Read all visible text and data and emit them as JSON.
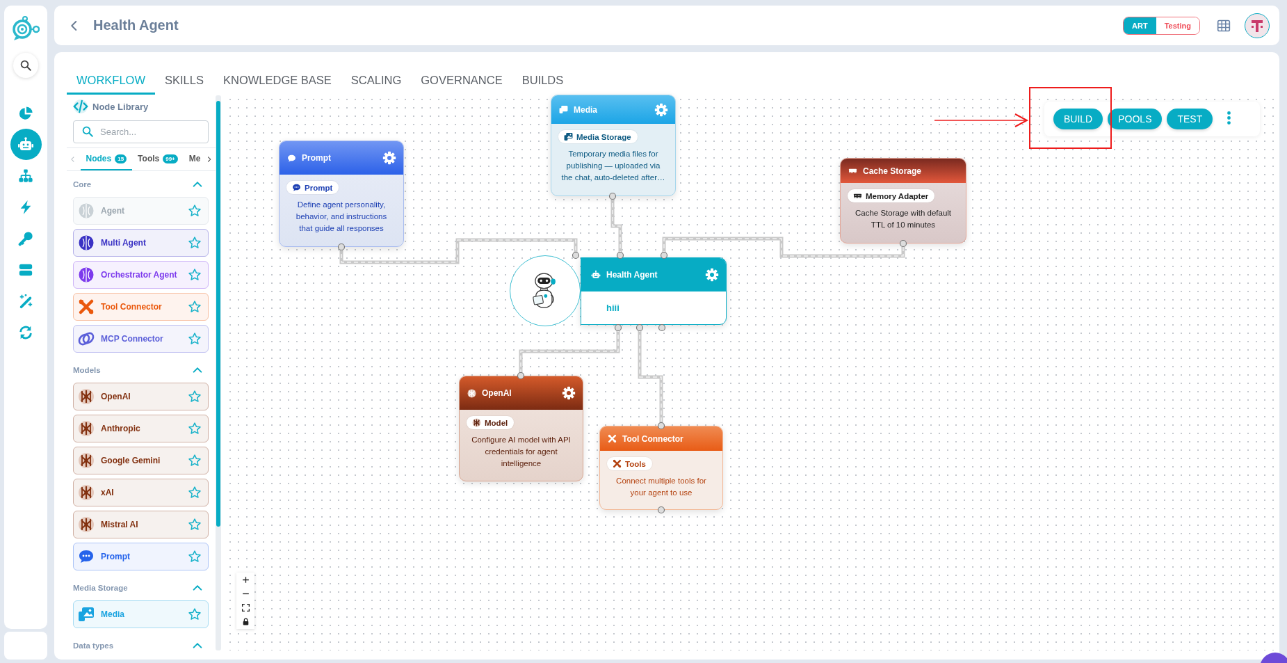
{
  "rail": {
    "items": [
      {
        "selected": false
      },
      {
        "selected": true
      },
      {
        "selected": false
      },
      {
        "selected": false
      },
      {
        "selected": false
      },
      {
        "selected": false
      },
      {
        "selected": false
      },
      {
        "selected": false
      }
    ]
  },
  "header": {
    "title": "Health Agent",
    "environments": [
      {
        "label": "ART",
        "selected": true
      },
      {
        "label": "Testing",
        "selected": false
      }
    ]
  },
  "tabs": [
    {
      "label": "WORKFLOW",
      "selected": true
    },
    {
      "label": "SKILLS",
      "selected": false
    },
    {
      "label": "KNOWLEDGE BASE",
      "selected": false
    },
    {
      "label": "SCALING",
      "selected": false
    },
    {
      "label": "GOVERNANCE",
      "selected": false
    },
    {
      "label": "BUILDS",
      "selected": false
    }
  ],
  "node_library": {
    "title": "Node Library",
    "search": {
      "placeholder": "Search..."
    },
    "tabs": [
      {
        "label": "Nodes",
        "count": "15",
        "selected": true
      },
      {
        "label": "Tools",
        "count": "99+",
        "selected": false
      },
      {
        "label": "Me",
        "selected": false
      }
    ],
    "sections": [
      {
        "title": "Core",
        "expanded": true,
        "items": [
          {
            "kind": "brain",
            "label": "Agent",
            "color": "#c9d1d6",
            "disabled": true,
            "starred": false
          },
          {
            "kind": "brain",
            "label": "Multi Agent",
            "color": "#3a32c4",
            "disabled": false,
            "starred": false
          },
          {
            "kind": "brain",
            "label": "Orchestrator Agent",
            "color": "#7c3aed",
            "disabled": false,
            "starred": false
          },
          {
            "kind": "tool",
            "label": "Tool Connector",
            "color": "#ea580c",
            "disabled": false,
            "starred": false
          },
          {
            "kind": "link",
            "label": "MCP Connector",
            "color": "#5b5fd9",
            "disabled": false,
            "starred": false
          }
        ]
      },
      {
        "title": "Models",
        "expanded": true,
        "items": [
          {
            "kind": "model",
            "label": "OpenAI",
            "color": "#82300f",
            "disabled": false,
            "starred": false
          },
          {
            "kind": "model",
            "label": "Anthropic",
            "color": "#82300f",
            "disabled": false,
            "starred": false
          },
          {
            "kind": "model",
            "label": "Google Gemini",
            "color": "#82300f",
            "disabled": false,
            "starred": false
          },
          {
            "kind": "model",
            "label": "xAI",
            "color": "#82300f",
            "disabled": false,
            "starred": false
          },
          {
            "kind": "model",
            "label": "Mistral AI",
            "color": "#82300f",
            "disabled": false,
            "starred": false
          },
          {
            "kind": "chat",
            "label": "Prompt",
            "color": "#2563eb",
            "disabled": false,
            "starred": false
          }
        ]
      },
      {
        "title": "Media Storage",
        "expanded": true,
        "items": [
          {
            "kind": "image",
            "label": "Media",
            "color": "#19a3e0",
            "disabled": false,
            "starred": false
          }
        ]
      },
      {
        "title": "Data types",
        "expanded": true
      }
    ]
  },
  "canvas": {
    "nodes": [
      {
        "kind": "prompt",
        "title": "Prompt",
        "settings": true,
        "badge": "Prompt",
        "description": "Define agent personality, behavior, and instructions that guide all responses"
      },
      {
        "kind": "media",
        "title": "Media",
        "settings": true,
        "badge": "Media Storage",
        "description": "Temporary media files for publishing — uploaded via the chat, auto-deleted after…"
      },
      {
        "kind": "cache",
        "title": "Cache Storage",
        "settings": false,
        "badge": "Memory Adapter",
        "description": "Cache Storage with default TTL of 10 minutes"
      },
      {
        "kind": "agent",
        "title": "Health Agent",
        "settings": true,
        "description": "hiii"
      },
      {
        "kind": "model",
        "title": "OpenAI",
        "settings": true,
        "badge": "Model",
        "description": "Configure AI model with API credentials for agent intelligence"
      },
      {
        "kind": "tool",
        "title": "Tool Connector",
        "settings": false,
        "badge": "Tools",
        "description": "Connect multiple tools for your agent to use"
      }
    ],
    "actions": [
      {
        "label": "BUILD"
      },
      {
        "label": "POOLS"
      },
      {
        "label": "TEST"
      }
    ]
  }
}
